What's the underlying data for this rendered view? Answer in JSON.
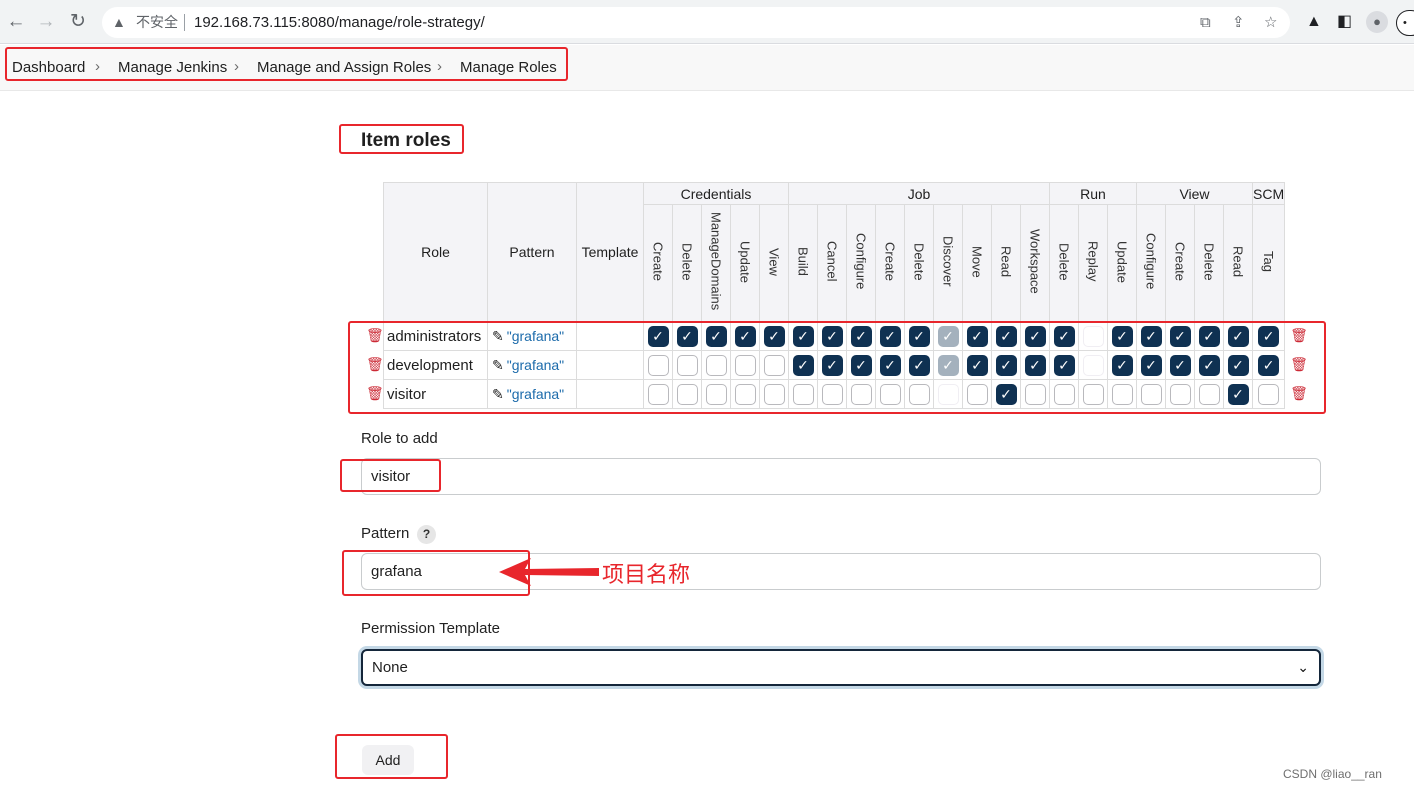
{
  "browser": {
    "security_label": "不安全",
    "url": "192.168.73.115:8080/manage/role-strategy/"
  },
  "breadcrumb": [
    "Dashboard",
    "Manage Jenkins",
    "Manage and Assign Roles",
    "Manage Roles"
  ],
  "section_title": "Item roles",
  "table": {
    "headers": {
      "role": "Role",
      "pattern": "Pattern",
      "template": "Template"
    },
    "groups": [
      {
        "name": "Credentials",
        "permissions": [
          "Create",
          "Delete",
          "ManageDomains",
          "Update",
          "View"
        ]
      },
      {
        "name": "Job",
        "permissions": [
          "Build",
          "Cancel",
          "Configure",
          "Create",
          "Delete",
          "Discover",
          "Move",
          "Read",
          "Workspace"
        ]
      },
      {
        "name": "Run",
        "permissions": [
          "Delete",
          "Replay",
          "Update"
        ]
      },
      {
        "name": "View",
        "permissions": [
          "Configure",
          "Create",
          "Delete",
          "Read"
        ]
      },
      {
        "name": "SCM",
        "permissions": [
          "Tag"
        ]
      }
    ],
    "rows": [
      {
        "role": "administrators",
        "pattern": "\"grafana\"",
        "template": "",
        "checks": [
          1,
          1,
          1,
          1,
          1,
          1,
          1,
          1,
          1,
          1,
          2,
          1,
          1,
          1,
          1,
          3,
          1,
          1,
          1,
          1,
          1,
          1
        ]
      },
      {
        "role": "development",
        "pattern": "\"grafana\"",
        "template": "",
        "checks": [
          0,
          0,
          0,
          0,
          0,
          1,
          1,
          1,
          1,
          1,
          2,
          1,
          1,
          1,
          1,
          3,
          1,
          1,
          1,
          1,
          1,
          1
        ]
      },
      {
        "role": "visitor",
        "pattern": "\"grafana\"",
        "template": "",
        "checks": [
          0,
          0,
          0,
          0,
          0,
          0,
          0,
          0,
          0,
          0,
          3,
          0,
          1,
          0,
          0,
          0,
          0,
          0,
          0,
          0,
          1,
          0
        ]
      }
    ]
  },
  "form": {
    "role_label": "Role to add",
    "role_value": "visitor",
    "pattern_label": "Pattern",
    "pattern_help": "?",
    "pattern_value": "grafana",
    "template_label": "Permission Template",
    "template_value": "None",
    "add_label": "Add"
  },
  "annotation": {
    "text": "项目名称",
    "color": "#e8262c"
  },
  "watermark": "CSDN @liao__ran",
  "colors": {
    "checked": "#0f3152",
    "disabled": "#a4b1bd",
    "annotation": "#e8262c"
  }
}
